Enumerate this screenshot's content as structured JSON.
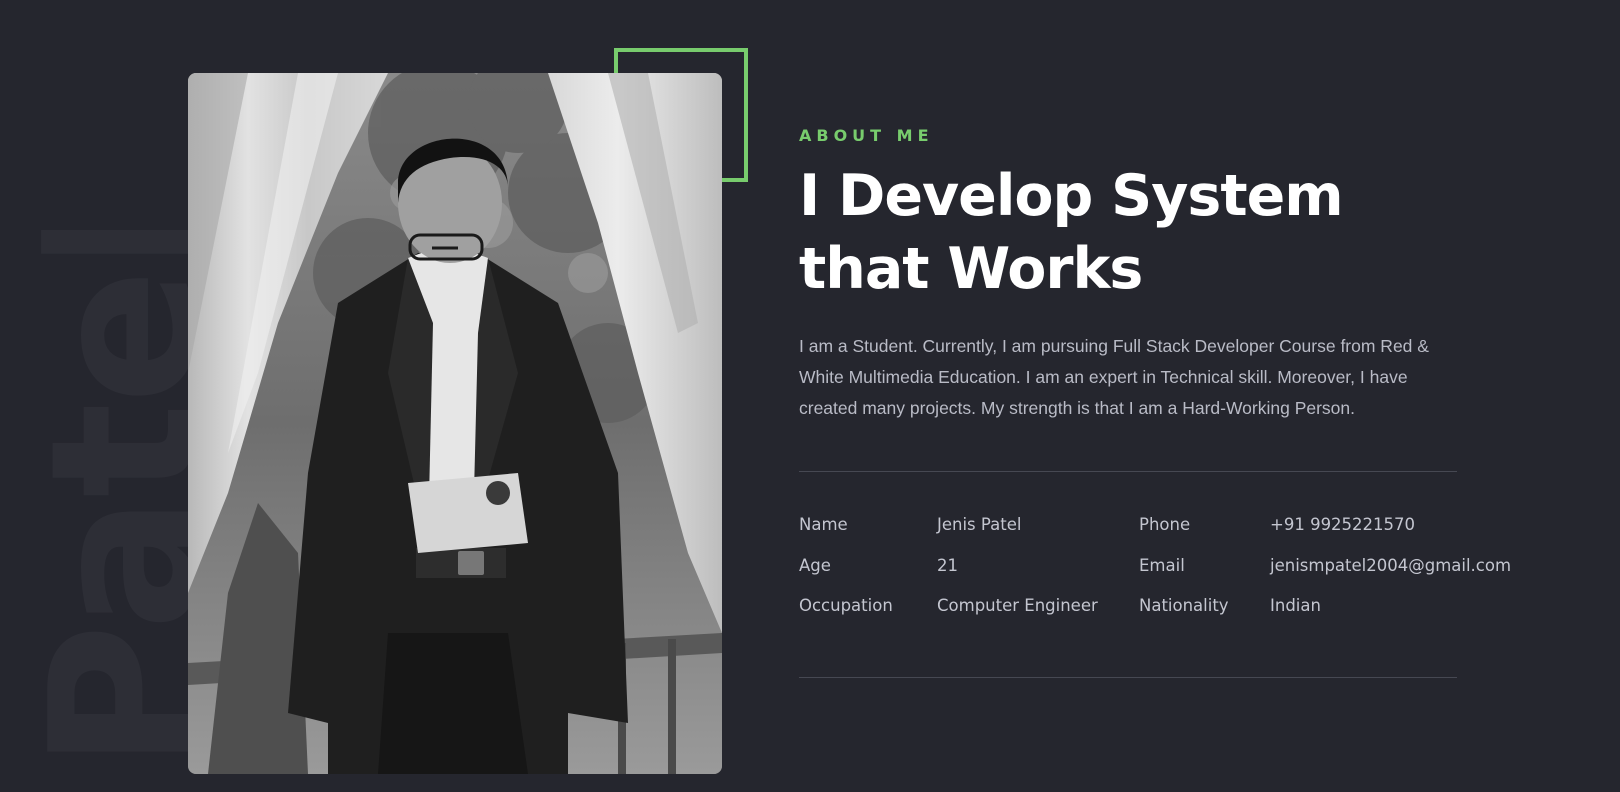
{
  "watermark": "Patel",
  "colors": {
    "background": "#25262e",
    "accent": "#78cc6d",
    "body_text": "#b9bbc6",
    "divider": "#464852"
  },
  "photo": {
    "alt": "Black and white portrait of a young man in a suit checking his wristwatch between white curtains"
  },
  "about": {
    "eyebrow": "ABOUT ME",
    "heading": "I Develop System that Works",
    "bio": "I am a Student. Currently, I am pursuing Full Stack Developer Course from Red & White Multimedia Education. I am an expert in Technical skill. Moreover, I have created many projects. My strength is that I am a Hard-Working Person."
  },
  "info": [
    {
      "label1": "Name",
      "value1": "Jenis Patel",
      "label2": "Phone",
      "value2": "+91 9925221570"
    },
    {
      "label1": "Age",
      "value1": "21",
      "label2": "Email",
      "value2": "jenismpatel2004@gmail.com"
    },
    {
      "label1": "Occupation",
      "value1": "Computer Engineer",
      "label2": "Nationality",
      "value2": "Indian"
    }
  ]
}
